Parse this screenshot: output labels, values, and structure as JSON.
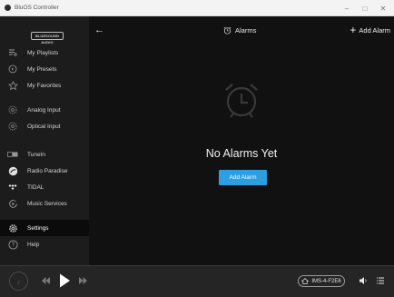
{
  "window": {
    "title": "BluOS Controller",
    "minimize_glyph": "–",
    "maximize_glyph": "□",
    "close_glyph": "✕"
  },
  "sidebar": {
    "logo": "BLUESOUND AUDIO",
    "items": [
      {
        "label": "My Playlists",
        "icon": "playlist-icon"
      },
      {
        "label": "My Presets",
        "icon": "presets-icon"
      },
      {
        "label": "My Favorites",
        "icon": "star-icon"
      },
      {
        "label": "Analog Input",
        "icon": "analog-input-icon"
      },
      {
        "label": "Optical Input",
        "icon": "optical-input-icon"
      },
      {
        "label": "TuneIn",
        "icon": "tunein-icon"
      },
      {
        "label": "Radio Paradise",
        "icon": "radio-paradise-icon"
      },
      {
        "label": "TIDAL",
        "icon": "tidal-icon"
      },
      {
        "label": "Music Services",
        "icon": "music-services-icon"
      },
      {
        "label": "Settings",
        "icon": "gear-icon",
        "active": true
      },
      {
        "label": "Help",
        "icon": "help-icon"
      }
    ]
  },
  "header": {
    "back_glyph": "←",
    "title": "Alarms",
    "add_label": "Add Alarm",
    "add_glyph": "+"
  },
  "empty_state": {
    "title": "No Alarms Yet",
    "button_label": "Add Alarm"
  },
  "player": {
    "device_name": "IMS-4-F2E6"
  },
  "colors": {
    "accent": "#2d9ee0",
    "sidebar_bg": "#1c1c1c",
    "main_bg": "#111111",
    "player_bg": "#252525"
  }
}
